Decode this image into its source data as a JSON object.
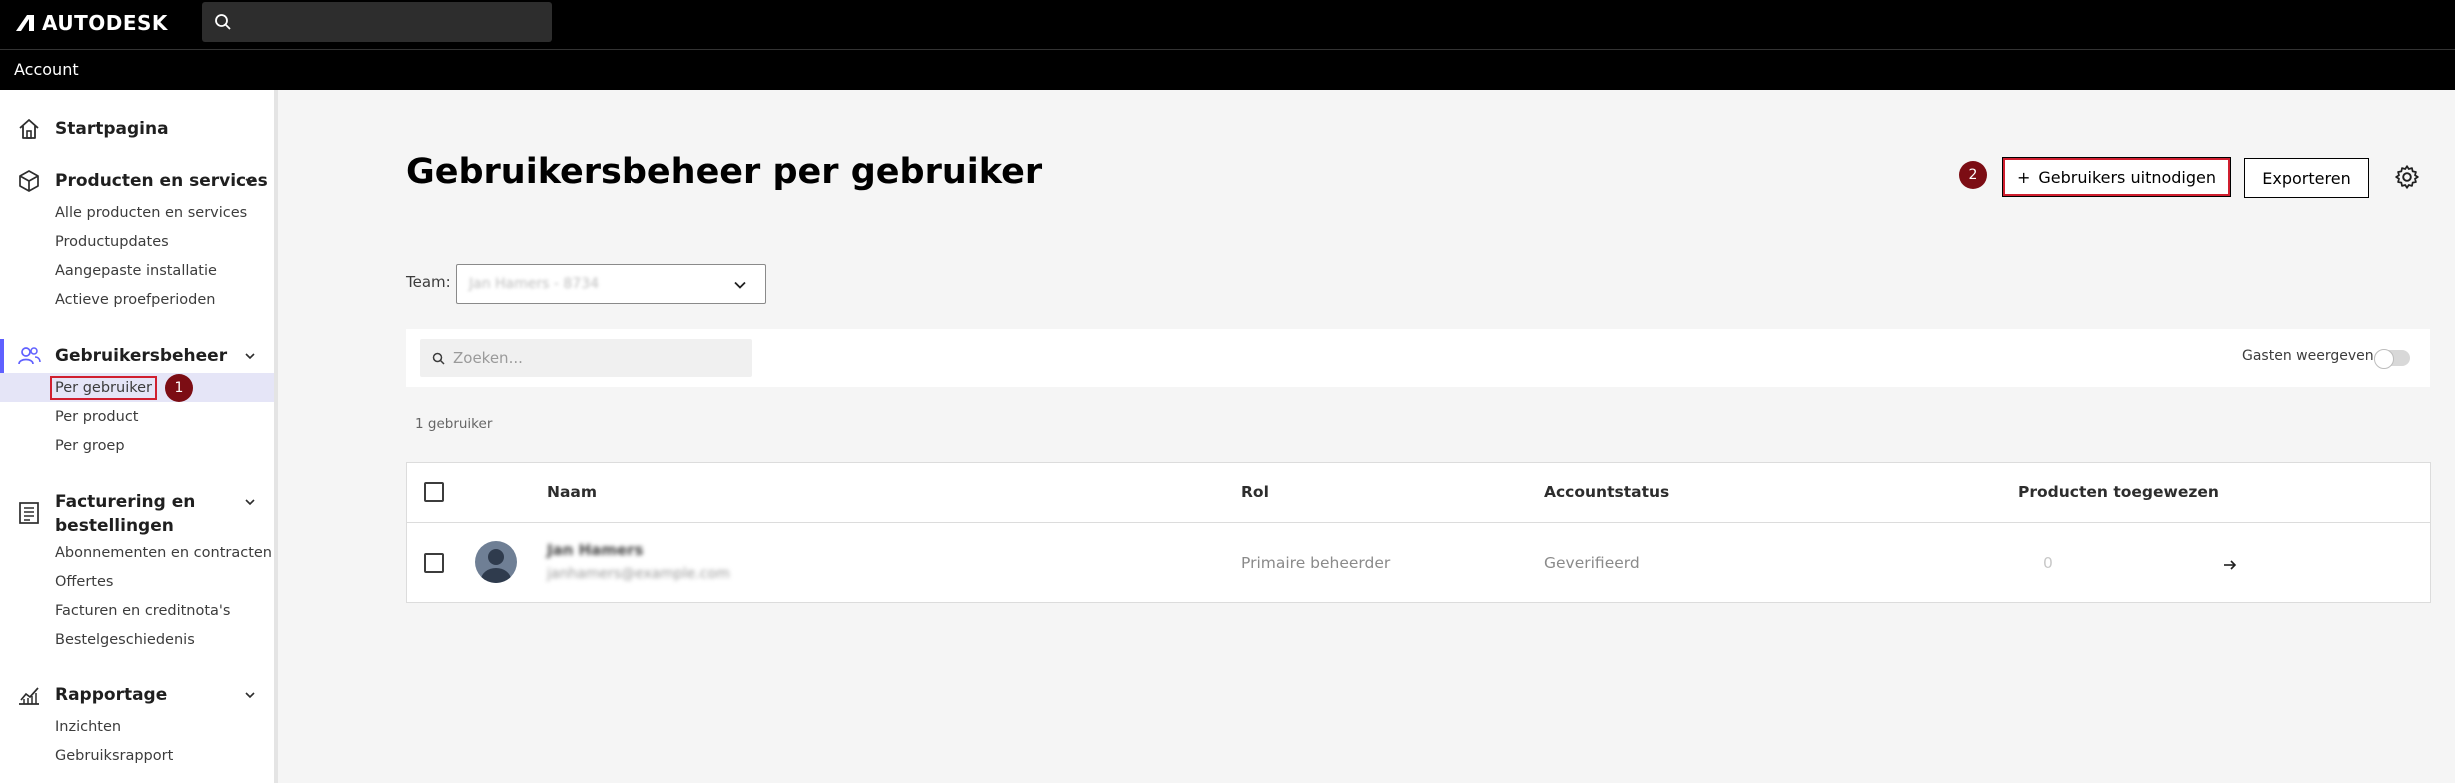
{
  "header": {
    "brand": "AUTODESK",
    "account_label": "Account"
  },
  "sidebar": {
    "home": "Startpagina",
    "sections": [
      {
        "title": "Producten en services",
        "items": [
          "Alle producten en services",
          "Productupdates",
          "Aangepaste installatie",
          "Actieve proefperioden"
        ]
      },
      {
        "title": "Gebruikersbeheer",
        "items": [
          "Per gebruiker",
          "Per product",
          "Per groep"
        ]
      },
      {
        "title_line1": "Facturering en",
        "title_line2": "bestellingen",
        "items": [
          "Abonnementen en contracten",
          "Offertes",
          "Facturen en creditnota's",
          "Bestelgeschiedenis"
        ]
      },
      {
        "title": "Rapportage",
        "items": [
          "Inzichten",
          "Gebruiksrapport"
        ]
      }
    ]
  },
  "annotations": {
    "badge1": "1",
    "badge2": "2"
  },
  "main": {
    "title": "Gebruikersbeheer per gebruiker",
    "invite_label": "Gebruikers uitnodigen",
    "invite_icon": "+",
    "export_label": "Exporteren",
    "team_label": "Team:",
    "team_value": "Jan Hamers - 8734",
    "search_placeholder": "Zoeken...",
    "guests_label": "Gasten weergeven",
    "guests_toggle_on": false,
    "user_count": "1 gebruiker"
  },
  "table": {
    "columns": [
      "Naam",
      "Rol",
      "Accountstatus",
      "Producten toegewezen"
    ],
    "rows": [
      {
        "name": "Jan Hamers",
        "email": "janhamers@example.com",
        "role": "Primaire beheerder",
        "status": "Geverifieerd",
        "products": "0"
      }
    ]
  },
  "colors": {
    "accent": "#5f60ff",
    "highlight": "#d01f2f",
    "badge": "#7c0d14",
    "selected_bg": "#e5e5f7"
  }
}
